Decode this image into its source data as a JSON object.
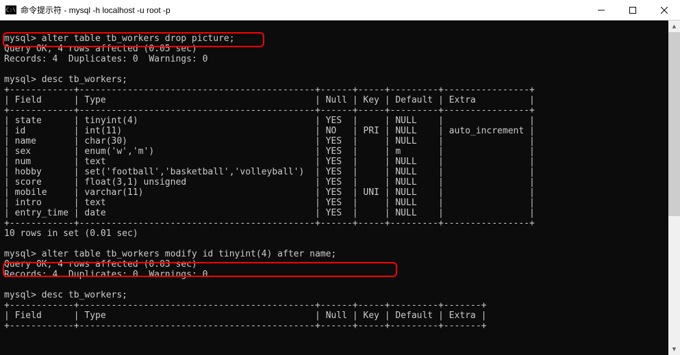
{
  "window": {
    "icon_text": "C:\\",
    "title": "命令提示符 - mysql   -h  localhost  -u  root  -p"
  },
  "terminal": {
    "lines": [
      "",
      "mysql> alter table tb_workers drop picture;",
      "Query OK, 4 rows affected (0.05 sec)",
      "Records: 4  Duplicates: 0  Warnings: 0",
      "",
      "mysql> desc tb_workers;",
      "+------------+--------------------------------------------+------+-----+---------+----------------+",
      "| Field      | Type                                       | Null | Key | Default | Extra          |",
      "+------------+--------------------------------------------+------+-----+---------+----------------+",
      "| state      | tinyint(4)                                 | YES  |     | NULL    |                |",
      "| id         | int(11)                                    | NO   | PRI | NULL    | auto_increment |",
      "| name       | char(30)                                   | YES  |     | NULL    |                |",
      "| sex        | enum('w','m')                              | YES  |     | m       |                |",
      "| num        | text                                       | YES  |     | NULL    |                |",
      "| hobby      | set('football','basketball','volleyball')  | YES  |     | NULL    |                |",
      "| score      | float(3,1) unsigned                        | YES  |     | NULL    |                |",
      "| mobile     | varchar(11)                                | YES  | UNI | NULL    |                |",
      "| intro      | text                                       | YES  |     | NULL    |                |",
      "| entry_time | date                                       | YES  |     | NULL    |                |",
      "+------------+--------------------------------------------+------+-----+---------+----------------+",
      "10 rows in set (0.01 sec)",
      "",
      "mysql> alter table tb_workers modify id tinyint(4) after name;",
      "Query OK, 4 rows affected (0.03 sec)",
      "Records: 4  Duplicates: 0  Warnings: 0",
      "",
      "mysql> desc tb_workers;",
      "+------------+--------------------------------------------+------+-----+---------+-------+",
      "| Field      | Type                                       | Null | Key | Default | Extra |",
      "+------------+--------------------------------------------+------+-----+---------+-------+"
    ]
  },
  "annotations": {
    "box1_target": "mysql> alter table tb_workers drop picture;",
    "box2_target": "mysql> alter table tb_workers modify id tinyint(4) after name;"
  }
}
